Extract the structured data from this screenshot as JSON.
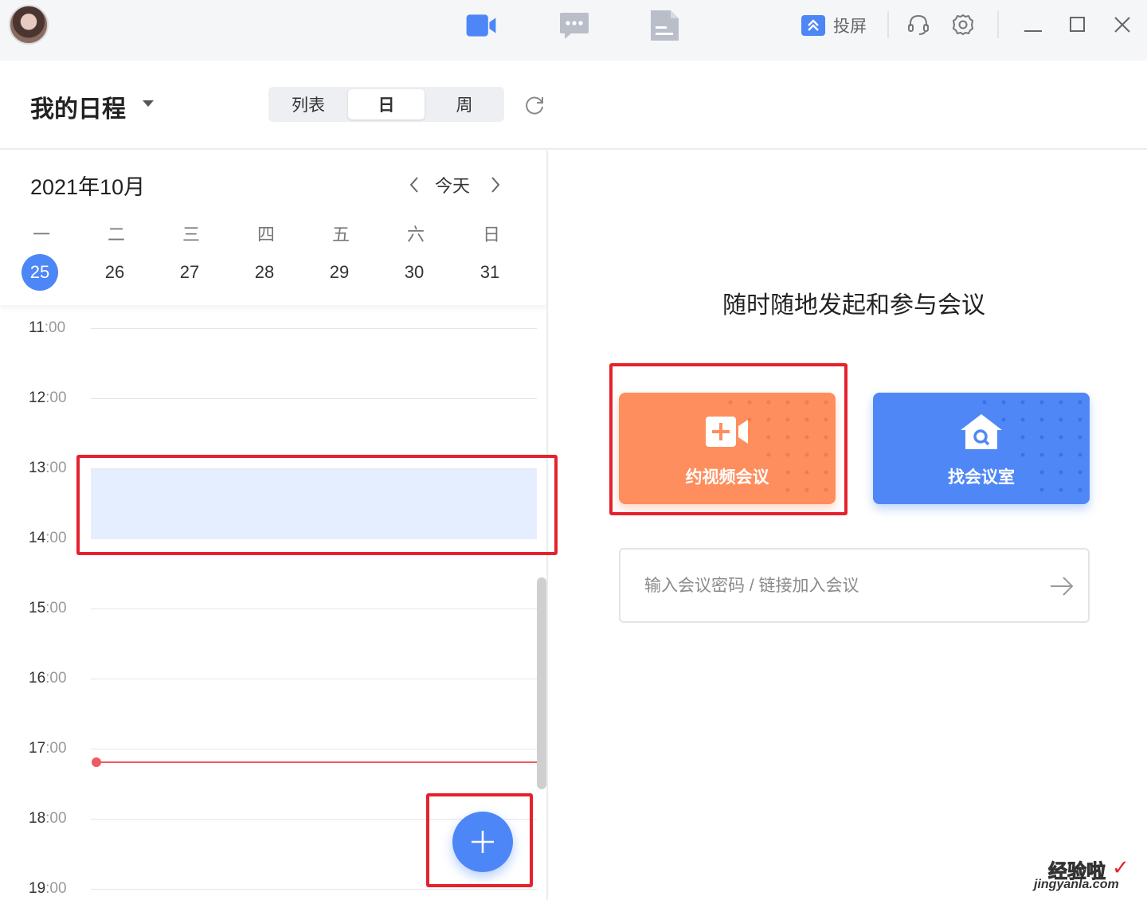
{
  "topbar": {
    "cast_label": "投屏",
    "accent": "#4d86f7"
  },
  "header": {
    "title": "我的日程",
    "views": [
      "列表",
      "日",
      "周"
    ],
    "active_view": "日"
  },
  "calendar": {
    "month_label": "2021年10月",
    "today_label": "今天",
    "weekdays": [
      "一",
      "二",
      "三",
      "四",
      "五",
      "六",
      "日"
    ],
    "dates": [
      "25",
      "26",
      "27",
      "28",
      "29",
      "30",
      "31"
    ],
    "selected_date": "25",
    "hours": [
      {
        "h": "11",
        "m": "00"
      },
      {
        "h": "12",
        "m": "00"
      },
      {
        "h": "13",
        "m": "00"
      },
      {
        "h": "14",
        "m": "00"
      },
      {
        "h": "15",
        "m": "00"
      },
      {
        "h": "16",
        "m": "00"
      },
      {
        "h": "17",
        "m": "00"
      },
      {
        "h": "18",
        "m": "00"
      },
      {
        "h": "19",
        "m": "00"
      }
    ],
    "hour_separator": ":",
    "busy_color": "#e5eeff",
    "now_line_color": "#ee5b62"
  },
  "main": {
    "slogan": "随时随地发起和参与会议",
    "schedule_button": "约视频会议",
    "schedule_color": "#fe8e5e",
    "find_room_button": "找会议室",
    "find_room_color": "#4f87f6",
    "join_placeholder": "输入会议密码 / 链接加入会议",
    "join_value": ""
  },
  "watermark": {
    "cn": "经验啦",
    "check": "✓",
    "en": "jingyanla.com"
  },
  "icons": [
    "avatar",
    "video-icon",
    "chat-icon",
    "document-icon",
    "cast-icon",
    "headset-icon",
    "gear-icon",
    "minimize-icon",
    "maximize-icon",
    "close-icon",
    "refresh-icon",
    "chevron-left-icon",
    "chevron-right-icon",
    "add-icon",
    "video-add-icon",
    "house-search-icon",
    "arrow-right-icon"
  ]
}
